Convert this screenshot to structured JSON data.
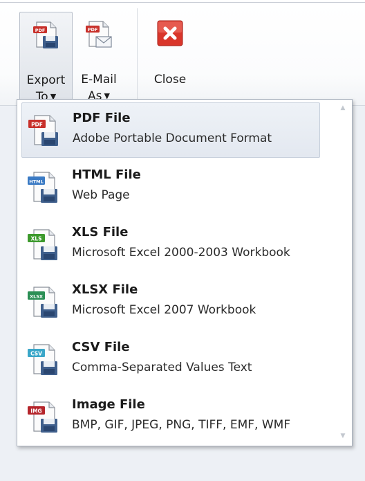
{
  "toolbar": {
    "export": {
      "line1": "Export",
      "line2": "To",
      "icon": "pdf-save-icon"
    },
    "email": {
      "line1": "E-Mail",
      "line2": "As",
      "icon": "pdf-mail-icon"
    },
    "close": {
      "label": "Close",
      "icon": "close-icon"
    }
  },
  "menu": {
    "items": [
      {
        "title": "PDF File",
        "desc": "Adobe Portable Document Format",
        "badge": "PDF",
        "color": "#c8312b",
        "selected": true
      },
      {
        "title": "HTML File",
        "desc": "Web Page",
        "badge": "HTML",
        "color": "#3a7ac4"
      },
      {
        "title": "XLS File",
        "desc": "Microsoft Excel 2000-2003 Workbook",
        "badge": "XLS",
        "color": "#3d9a2d"
      },
      {
        "title": "XLSX File",
        "desc": "Microsoft Excel 2007 Workbook",
        "badge": "XLSX",
        "color": "#2b8f55"
      },
      {
        "title": "CSV File",
        "desc": "Comma-Separated Values Text",
        "badge": "CSV",
        "color": "#3aa6c8"
      },
      {
        "title": "Image File",
        "desc": "BMP, GIF, JPEG, PNG, TIFF, EMF, WMF",
        "badge": "IMG",
        "color": "#b5252b"
      }
    ]
  },
  "colors": {
    "close_red": "#d9362b",
    "selected_bg": "#e8edf4"
  }
}
